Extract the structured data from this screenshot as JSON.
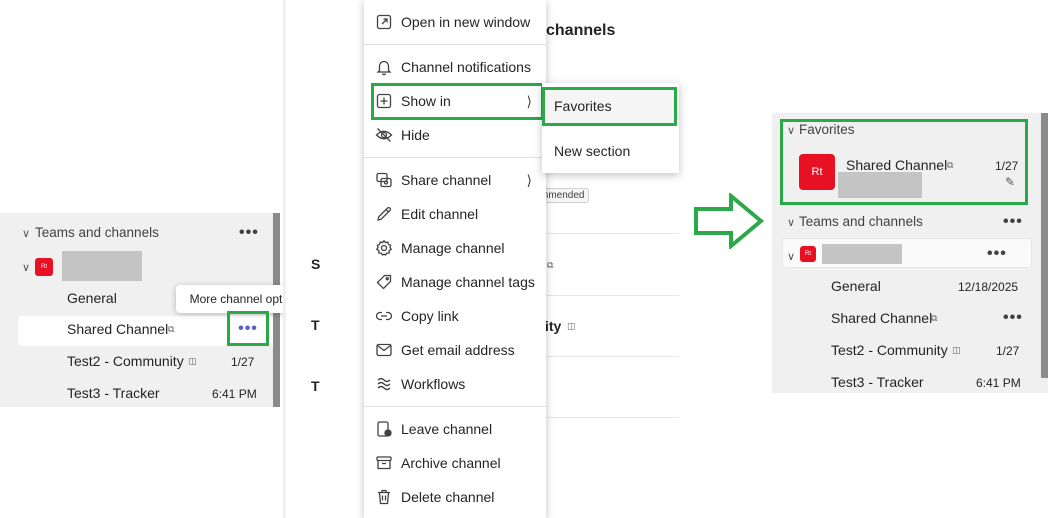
{
  "left_panel": {
    "section_header": "Teams and channels",
    "team_avatar_initials": "Rt",
    "channels": [
      {
        "name": "General",
        "meta": ""
      },
      {
        "name": "Shared Channel",
        "meta": ""
      },
      {
        "name": "Test2 - Community",
        "meta": "1/27"
      },
      {
        "name": "Test3 - Tracker",
        "meta": "6:41 PM"
      }
    ],
    "tooltip": "More channel options",
    "more_glyph": "•••"
  },
  "background_page": {
    "title_fragment": "channels",
    "badge_fragment": "mmended",
    "row_letter_1": "S",
    "row_letter_2": "T",
    "row_letter_3": "T",
    "row_fragment": "ity"
  },
  "context_menu": {
    "items": [
      {
        "label": "Open in new window",
        "icon": "open-window-icon"
      },
      {
        "label": "Channel notifications",
        "icon": "bell-icon"
      },
      {
        "label": "Show in",
        "icon": "plus-square-icon",
        "has_submenu": true
      },
      {
        "label": "Hide",
        "icon": "eye-off-icon"
      },
      {
        "label": "Share channel",
        "icon": "share-channel-icon",
        "has_submenu": true
      },
      {
        "label": "Edit channel",
        "icon": "pencil-icon"
      },
      {
        "label": "Manage channel",
        "icon": "gear-icon"
      },
      {
        "label": "Manage channel tags",
        "icon": "tag-icon"
      },
      {
        "label": "Copy link",
        "icon": "link-icon"
      },
      {
        "label": "Get email address",
        "icon": "mail-icon"
      },
      {
        "label": "Workflows",
        "icon": "workflows-icon"
      },
      {
        "label": "Leave channel",
        "icon": "leave-icon"
      },
      {
        "label": "Archive channel",
        "icon": "archive-icon"
      },
      {
        "label": "Delete channel",
        "icon": "trash-icon"
      }
    ],
    "submenu": [
      {
        "label": "Favorites"
      },
      {
        "label": "New section"
      }
    ]
  },
  "right_panel": {
    "favorites_header": "Favorites",
    "favorite_item": {
      "name": "Shared Channel",
      "avatar_initials": "Rt",
      "meta": "1/27"
    },
    "section_header": "Teams and channels",
    "team_avatar_initials": "Rt",
    "channels": [
      {
        "name": "General",
        "meta": "12/18/2025"
      },
      {
        "name": "Shared Channel",
        "meta": ""
      },
      {
        "name": "Test2 - Community",
        "meta": "1/27"
      },
      {
        "name": "Test3 - Tracker",
        "meta": "6:41 PM"
      }
    ],
    "more_glyph": "•••"
  },
  "colors": {
    "highlight_green": "#2ba847",
    "avatar_red": "#e81123",
    "accent_purple": "#5b5fc7",
    "panel_gray": "#f0f0f0"
  }
}
